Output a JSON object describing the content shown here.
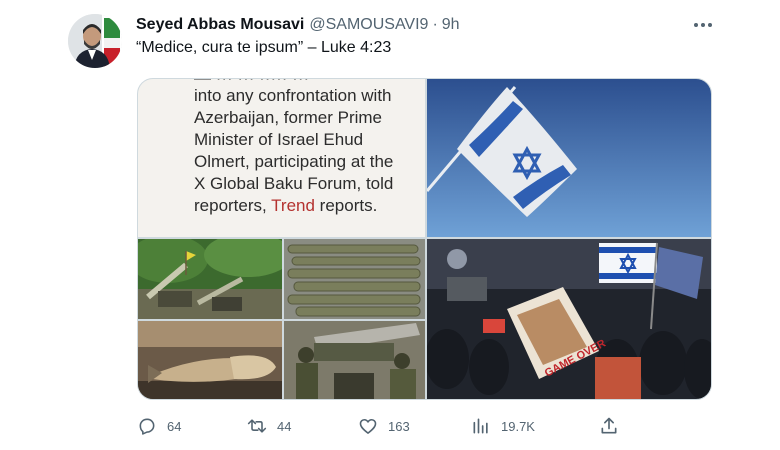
{
  "tweet": {
    "author_name": "Seyed Abbas Mousavi",
    "handle": "@SAMOUSAVI9",
    "separator": "·",
    "time": "9h",
    "text": "“Medice, cura te ipsum” – Luke 4:23"
  },
  "media": {
    "article_lines": [
      "into any confrontation with",
      "Azerbaijan, former Prime",
      "Minister of Israel Ehud",
      "Olmert, participating at the",
      "X Global Baku Forum, told"
    ],
    "article_last_line_prefix": "reporters, ",
    "article_highlight": "Trend",
    "article_last_line_suffix": " reports.",
    "protest_sign_text": "GAME OVER"
  },
  "actions": {
    "replies": "64",
    "reposts": "44",
    "likes": "163",
    "views": "19.7K"
  },
  "colors": {
    "text_primary": "#0f1419",
    "text_secondary": "#536471",
    "border": "#cfd9de",
    "article_highlight": "#b4322f",
    "flag_blue": "#1e4fb0"
  }
}
